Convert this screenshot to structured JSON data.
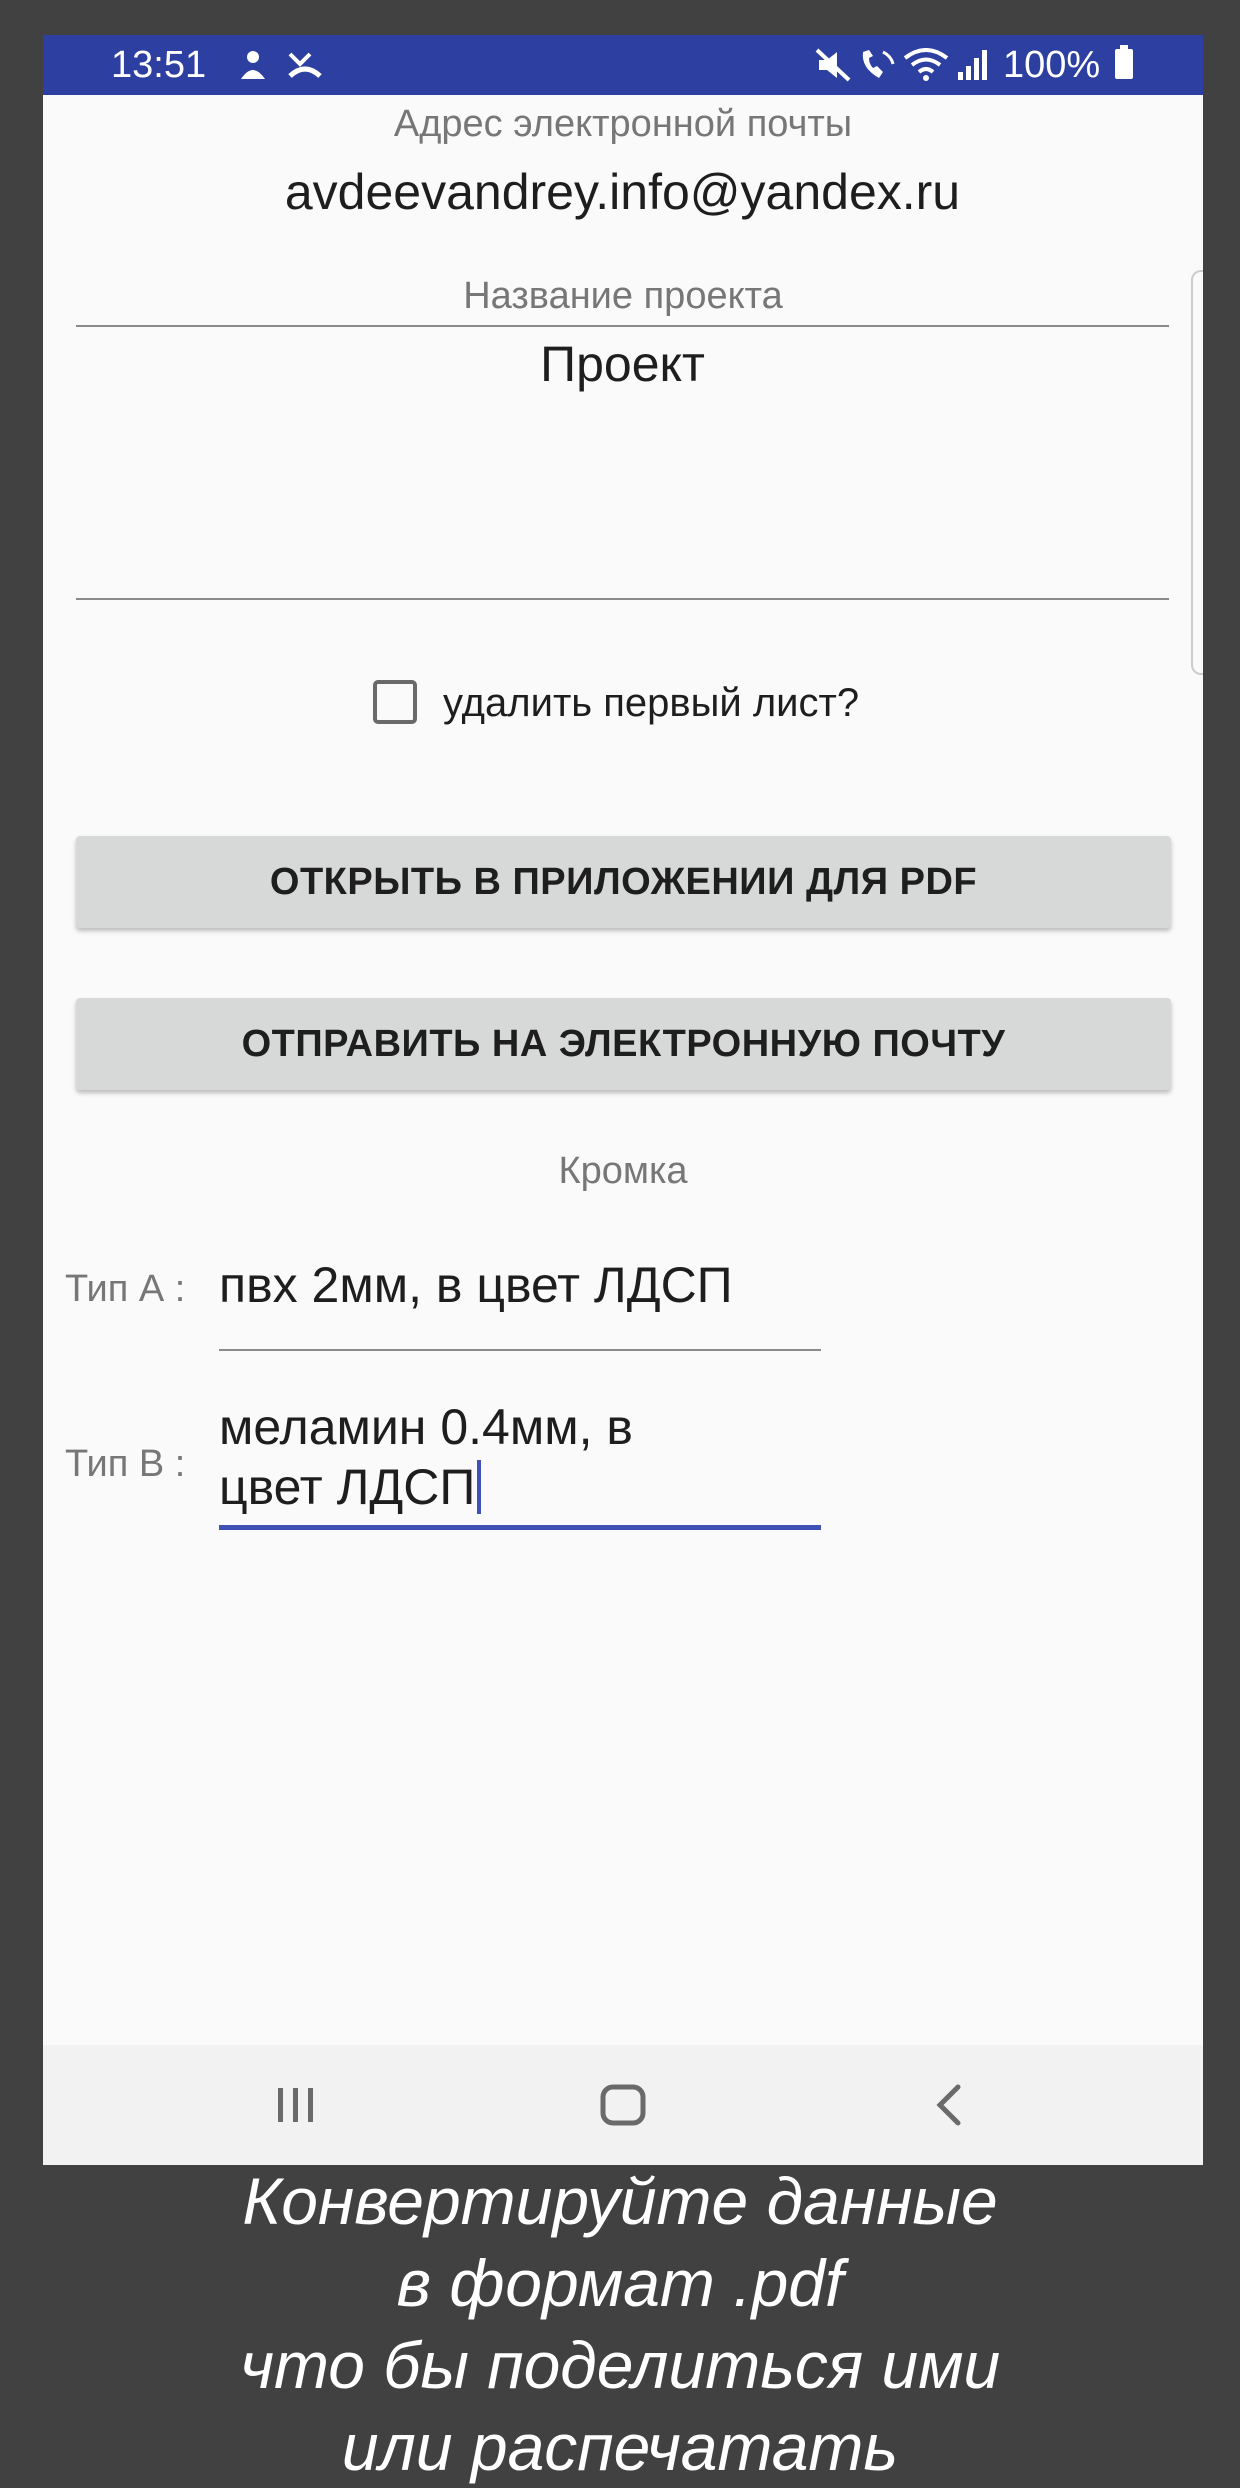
{
  "status_bar": {
    "time": "13:51",
    "battery": "100%",
    "icons": [
      "person-icon",
      "missed-call-icon",
      "mute-icon",
      "wifi-call-icon",
      "wifi-icon",
      "signal-icon",
      "battery-icon"
    ],
    "background": "#2d3fa0"
  },
  "form": {
    "email_label": "Адрес электронной почты",
    "email_value": "avdeevandrey.info@yandex.ru",
    "project_label": "Название проекта",
    "project_value": "Проект",
    "delete_first_sheet_label": "удалить первый лист?",
    "delete_first_sheet_checked": false,
    "open_pdf_button": "ОТКРЫТЬ В ПРИЛОЖЕНИИ ДЛЯ PDF",
    "send_email_button": "ОТПРАВИТЬ НА ЭЛЕКТРОННУЮ ПОЧТУ",
    "edge_label": "Кромка",
    "type_a_label": "Тип А :",
    "type_a_value": "пвх 2мм, в цвет ЛДСП",
    "type_b_label": "Тип В :",
    "type_b_value_line1": "меламин 0.4мм, в",
    "type_b_value_line2": "цвет ЛДСП",
    "accent": "#3f51b5"
  },
  "navbar": {
    "icons": [
      "recent-apps-icon",
      "home-icon",
      "back-icon"
    ]
  },
  "caption": {
    "line1": "Конвертируйте данные",
    "line2": "в формат .pdf",
    "line3": "что бы поделиться ими",
    "line4": "или распечатать"
  }
}
